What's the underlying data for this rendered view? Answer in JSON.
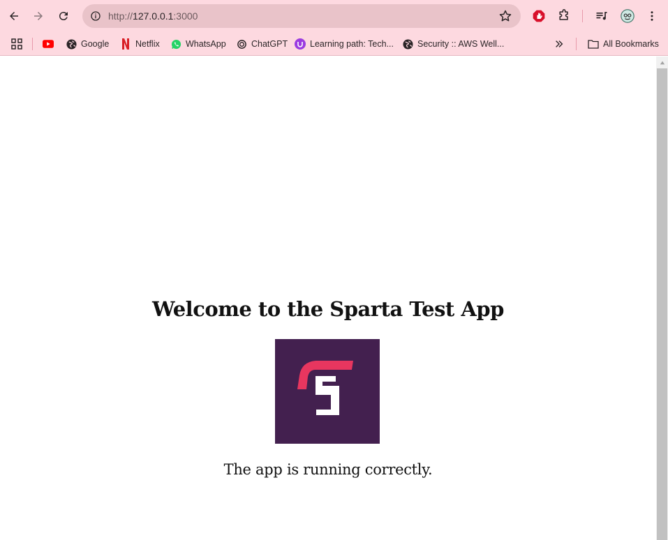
{
  "browser": {
    "url_prefix": "http://",
    "url_host": "127.0.0.1",
    "url_port": ":3000",
    "bookmarks": [
      {
        "label": "",
        "icon": "youtube-icon"
      },
      {
        "label": "Google",
        "icon": "globe-icon"
      },
      {
        "label": "Netflix",
        "icon": "netflix-icon"
      },
      {
        "label": "WhatsApp",
        "icon": "whatsapp-icon"
      },
      {
        "label": "ChatGPT",
        "icon": "chatgpt-icon"
      },
      {
        "label": "Learning path: Tech...",
        "icon": "learning-icon"
      },
      {
        "label": "Security :: AWS Well...",
        "icon": "globe-icon"
      }
    ],
    "all_bookmarks": "All Bookmarks"
  },
  "page": {
    "heading": "Welcome to the Sparta Test App",
    "status": "The app is running correctly.",
    "logo_bg": "#43204f",
    "logo_accent": "#e8365f"
  },
  "colors": {
    "toolbar": "#fdd9e0",
    "omnibox": "#e9c3c9"
  }
}
